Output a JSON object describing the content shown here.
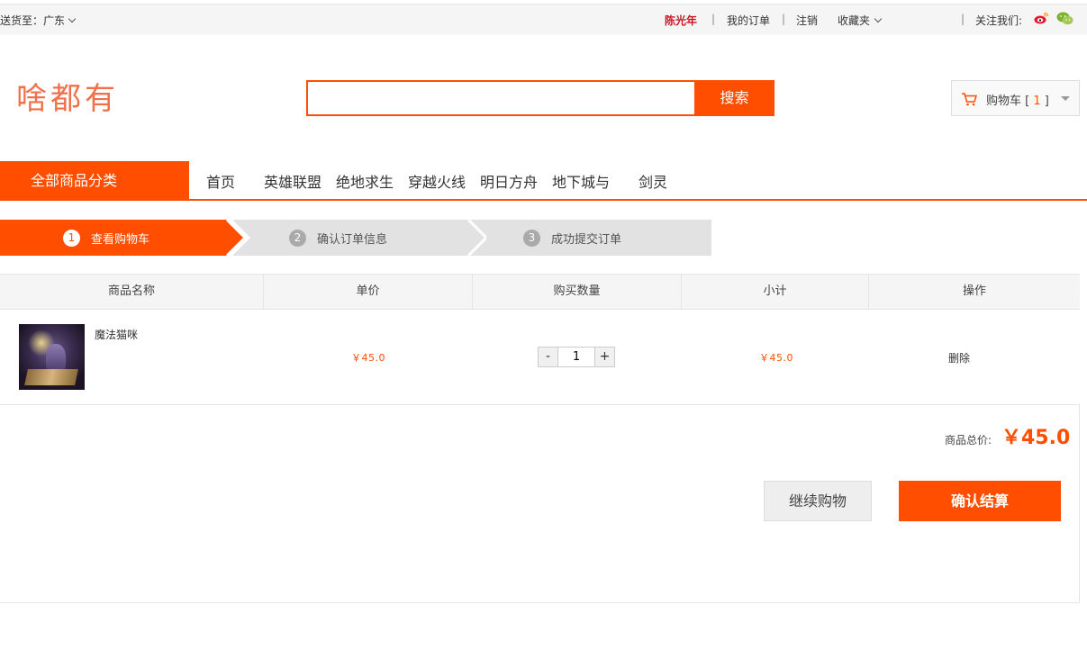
{
  "topbar": {
    "deliver_to": "送货至：广东",
    "user": "陈光年",
    "sep": "|",
    "my_orders": "我的订单",
    "logout": "注销",
    "favorites": "收藏夹",
    "follow_us": "关注我们:"
  },
  "header": {
    "logo": "啥都有",
    "search_placeholder": "",
    "search_button": "搜索",
    "cart_label": "购物车",
    "cart_open": "[",
    "cart_count": "1",
    "cart_close": "]"
  },
  "nav": {
    "all_categories": "全部商品分类",
    "items": [
      "首页",
      "英雄联盟",
      "绝地求生",
      "穿越火线",
      "明日方舟",
      "地下城与",
      "剑灵"
    ]
  },
  "steps": [
    {
      "num": "1",
      "label": "查看购物车"
    },
    {
      "num": "2",
      "label": "确认订单信息"
    },
    {
      "num": "3",
      "label": "成功提交订单"
    }
  ],
  "table": {
    "headers": [
      "商品名称",
      "单价",
      "购买数量",
      "小计",
      "操作"
    ],
    "rows": [
      {
        "name": "魔法猫咪",
        "price": "￥45.0",
        "qty": "1",
        "subtotal": "￥45.0",
        "action": "删除"
      }
    ],
    "minus": "-",
    "plus": "+"
  },
  "summary": {
    "total_label": "商品总价:",
    "total_value": "￥45.0",
    "continue": "继续购物",
    "confirm": "确认结算"
  },
  "colors": {
    "accent": "#ff4e00",
    "user": "#c81623"
  }
}
